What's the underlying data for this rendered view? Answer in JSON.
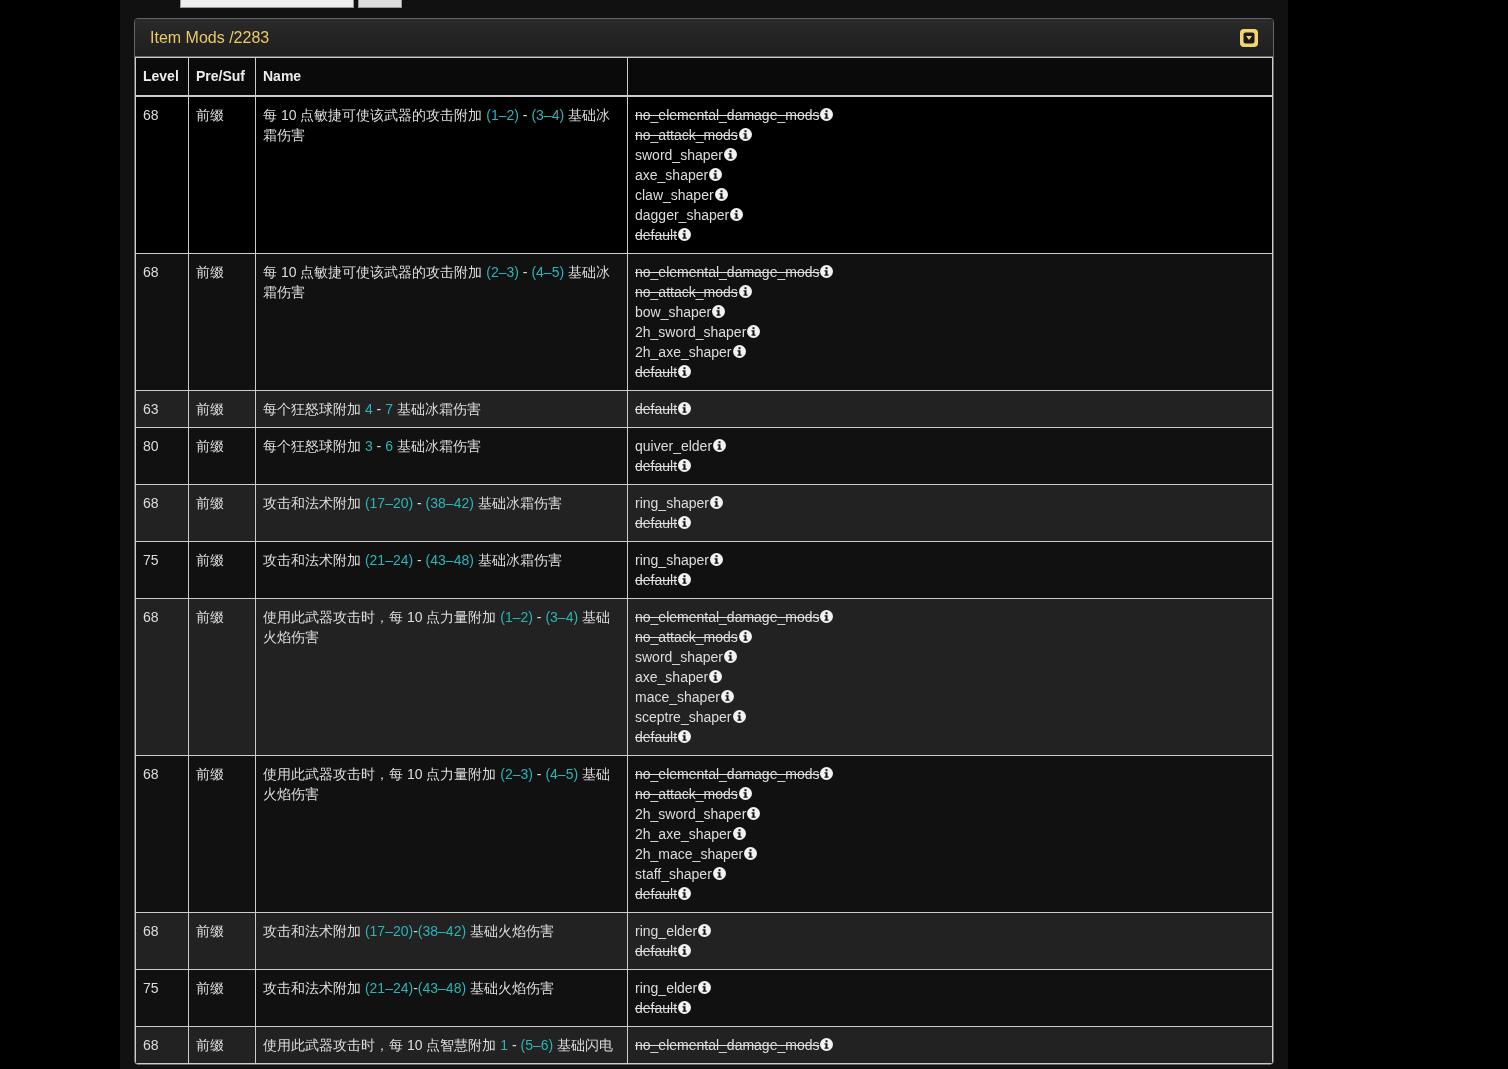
{
  "panel": {
    "title": "Item Mods /2283",
    "collapsed": false
  },
  "table": {
    "columns": [
      "Level",
      "Pre/Suf",
      "Name",
      ""
    ],
    "rows": [
      {
        "level": "68",
        "type": "前缀",
        "highlighted": true,
        "name": [
          {
            "kind": "plain",
            "text": "每 10 点敏捷可使该武器的攻击附加 "
          },
          {
            "kind": "value",
            "text": "(1–2)"
          },
          {
            "kind": "plain",
            "text": " - "
          },
          {
            "kind": "value",
            "text": "(3–4)"
          },
          {
            "kind": "plain",
            "text": " 基础冰霜伤害"
          }
        ],
        "tags": [
          {
            "text": "no_elemental_damage_mods",
            "struck": true
          },
          {
            "text": "no_attack_mods",
            "struck": true
          },
          {
            "text": "sword_shaper",
            "struck": false
          },
          {
            "text": "axe_shaper",
            "struck": false
          },
          {
            "text": "claw_shaper",
            "struck": false
          },
          {
            "text": "dagger_shaper",
            "struck": false
          },
          {
            "text": "default",
            "struck": true
          }
        ]
      },
      {
        "level": "68",
        "type": "前缀",
        "highlighted": false,
        "name": [
          {
            "kind": "plain",
            "text": "每 10 点敏捷可使该武器的攻击附加 "
          },
          {
            "kind": "value",
            "text": "(2–3)"
          },
          {
            "kind": "plain",
            "text": " - "
          },
          {
            "kind": "value",
            "text": "(4–5)"
          },
          {
            "kind": "plain",
            "text": " 基础冰霜伤害"
          }
        ],
        "tags": [
          {
            "text": "no_elemental_damage_mods",
            "struck": true
          },
          {
            "text": "no_attack_mods",
            "struck": true
          },
          {
            "text": "bow_shaper",
            "struck": false
          },
          {
            "text": "2h_sword_shaper",
            "struck": false
          },
          {
            "text": "2h_axe_shaper",
            "struck": false
          },
          {
            "text": "default",
            "struck": true
          }
        ]
      },
      {
        "level": "63",
        "type": "前缀",
        "highlighted": false,
        "name": [
          {
            "kind": "plain",
            "text": "每个狂怒球附加 "
          },
          {
            "kind": "value",
            "text": "4"
          },
          {
            "kind": "plain",
            "text": " - "
          },
          {
            "kind": "value",
            "text": "7"
          },
          {
            "kind": "plain",
            "text": " 基础冰霜伤害"
          }
        ],
        "tags": [
          {
            "text": "default",
            "struck": true
          }
        ]
      },
      {
        "level": "80",
        "type": "前缀",
        "highlighted": false,
        "name": [
          {
            "kind": "plain",
            "text": "每个狂怒球附加 "
          },
          {
            "kind": "value",
            "text": "3"
          },
          {
            "kind": "plain",
            "text": " - "
          },
          {
            "kind": "value",
            "text": "6"
          },
          {
            "kind": "plain",
            "text": " 基础冰霜伤害"
          }
        ],
        "tags": [
          {
            "text": "quiver_elder",
            "struck": false
          },
          {
            "text": "default",
            "struck": true
          }
        ]
      },
      {
        "level": "68",
        "type": "前缀",
        "highlighted": false,
        "name": [
          {
            "kind": "plain",
            "text": "攻击和法术附加 "
          },
          {
            "kind": "value",
            "text": "(17–20)"
          },
          {
            "kind": "plain",
            "text": " - "
          },
          {
            "kind": "value",
            "text": "(38–42)"
          },
          {
            "kind": "plain",
            "text": " 基础冰霜伤害"
          }
        ],
        "tags": [
          {
            "text": "ring_shaper",
            "struck": false
          },
          {
            "text": "default",
            "struck": true
          }
        ]
      },
      {
        "level": "75",
        "type": "前缀",
        "highlighted": false,
        "name": [
          {
            "kind": "plain",
            "text": "攻击和法术附加 "
          },
          {
            "kind": "value",
            "text": "(21–24)"
          },
          {
            "kind": "plain",
            "text": " - "
          },
          {
            "kind": "value",
            "text": "(43–48)"
          },
          {
            "kind": "plain",
            "text": " 基础冰霜伤害"
          }
        ],
        "tags": [
          {
            "text": "ring_shaper",
            "struck": false
          },
          {
            "text": "default",
            "struck": true
          }
        ]
      },
      {
        "level": "68",
        "type": "前缀",
        "highlighted": false,
        "name": [
          {
            "kind": "plain",
            "text": "使用此武器攻击时，每 10 点力量附加 "
          },
          {
            "kind": "value",
            "text": "(1–2)"
          },
          {
            "kind": "plain",
            "text": " - "
          },
          {
            "kind": "value",
            "text": "(3–4)"
          },
          {
            "kind": "plain",
            "text": " 基础火焰伤害"
          }
        ],
        "tags": [
          {
            "text": "no_elemental_damage_mods",
            "struck": true
          },
          {
            "text": "no_attack_mods",
            "struck": true
          },
          {
            "text": "sword_shaper",
            "struck": false
          },
          {
            "text": "axe_shaper",
            "struck": false
          },
          {
            "text": "mace_shaper",
            "struck": false
          },
          {
            "text": "sceptre_shaper",
            "struck": false
          },
          {
            "text": "default",
            "struck": true
          }
        ]
      },
      {
        "level": "68",
        "type": "前缀",
        "highlighted": false,
        "name": [
          {
            "kind": "plain",
            "text": "使用此武器攻击时，每 10 点力量附加 "
          },
          {
            "kind": "value",
            "text": "(2–3)"
          },
          {
            "kind": "plain",
            "text": " - "
          },
          {
            "kind": "value",
            "text": "(4–5)"
          },
          {
            "kind": "plain",
            "text": " 基础火焰伤害"
          }
        ],
        "tags": [
          {
            "text": "no_elemental_damage_mods",
            "struck": true
          },
          {
            "text": "no_attack_mods",
            "struck": true
          },
          {
            "text": "2h_sword_shaper",
            "struck": false
          },
          {
            "text": "2h_axe_shaper",
            "struck": false
          },
          {
            "text": "2h_mace_shaper",
            "struck": false
          },
          {
            "text": "staff_shaper",
            "struck": false
          },
          {
            "text": "default",
            "struck": true
          }
        ]
      },
      {
        "level": "68",
        "type": "前缀",
        "highlighted": false,
        "name": [
          {
            "kind": "plain",
            "text": "攻击和法术附加 "
          },
          {
            "kind": "value",
            "text": "(17–20)"
          },
          {
            "kind": "plain",
            "text": "-"
          },
          {
            "kind": "value",
            "text": "(38–42)"
          },
          {
            "kind": "plain",
            "text": " 基础火焰伤害"
          }
        ],
        "tags": [
          {
            "text": "ring_elder",
            "struck": false
          },
          {
            "text": "default",
            "struck": true
          }
        ]
      },
      {
        "level": "75",
        "type": "前缀",
        "highlighted": false,
        "name": [
          {
            "kind": "plain",
            "text": "攻击和法术附加 "
          },
          {
            "kind": "value",
            "text": "(21–24)"
          },
          {
            "kind": "plain",
            "text": "-"
          },
          {
            "kind": "value",
            "text": "(43–48)"
          },
          {
            "kind": "plain",
            "text": " 基础火焰伤害"
          }
        ],
        "tags": [
          {
            "text": "ring_elder",
            "struck": false
          },
          {
            "text": "default",
            "struck": true
          }
        ]
      },
      {
        "level": "68",
        "type": "前缀",
        "highlighted": false,
        "name": [
          {
            "kind": "plain",
            "text": "使用此武器攻击时，每 10 点智慧附加 "
          },
          {
            "kind": "value",
            "text": "1"
          },
          {
            "kind": "plain",
            "text": " - "
          },
          {
            "kind": "value",
            "text": "(5–6)"
          },
          {
            "kind": "plain",
            "text": " 基础闪电"
          }
        ],
        "tags": [
          {
            "text": "no_elemental_damage_mods",
            "struck": true
          }
        ]
      }
    ]
  }
}
